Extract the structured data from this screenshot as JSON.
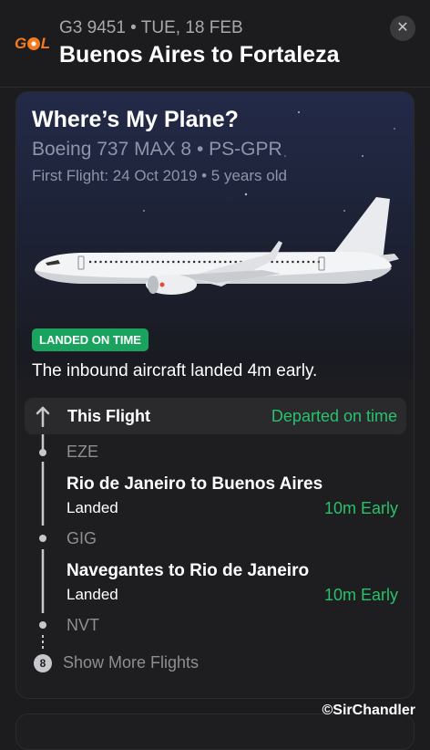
{
  "header": {
    "logo_text": "GOL",
    "subtitle": "G3 9451 • TUE, 18 FEB",
    "title": "Buenos Aires to Fortaleza",
    "close_icon": "close-icon"
  },
  "card": {
    "title": "Where’s My Plane?",
    "aircraft_model": "Boeing 737 MAX 8 • PS-GPR",
    "first_flight": "First Flight: 24 Oct 2019 • 5 years old",
    "badge": "LANDED ON TIME",
    "inbound_text": "The inbound aircraft landed 4m early.",
    "this_flight": {
      "label": "This Flight",
      "status": "Departed on time"
    },
    "airports": [
      "EZE",
      "GIG",
      "NVT"
    ],
    "routes": [
      {
        "name": "Rio de Janeiro to Buenos Aires",
        "status": "Landed",
        "delta": "10m Early"
      },
      {
        "name": "Navegantes to Rio de Janeiro",
        "status": "Landed",
        "delta": "10m Early"
      }
    ],
    "more_flights": {
      "count": "8",
      "label": "Show More Flights"
    }
  },
  "watermark": "©SirChandler",
  "colors": {
    "background": "#1c1c1e",
    "green": "#27c26c",
    "badge_green": "#1aa35e",
    "muted": "#8e95a8",
    "brand_orange": "#f47a20"
  }
}
